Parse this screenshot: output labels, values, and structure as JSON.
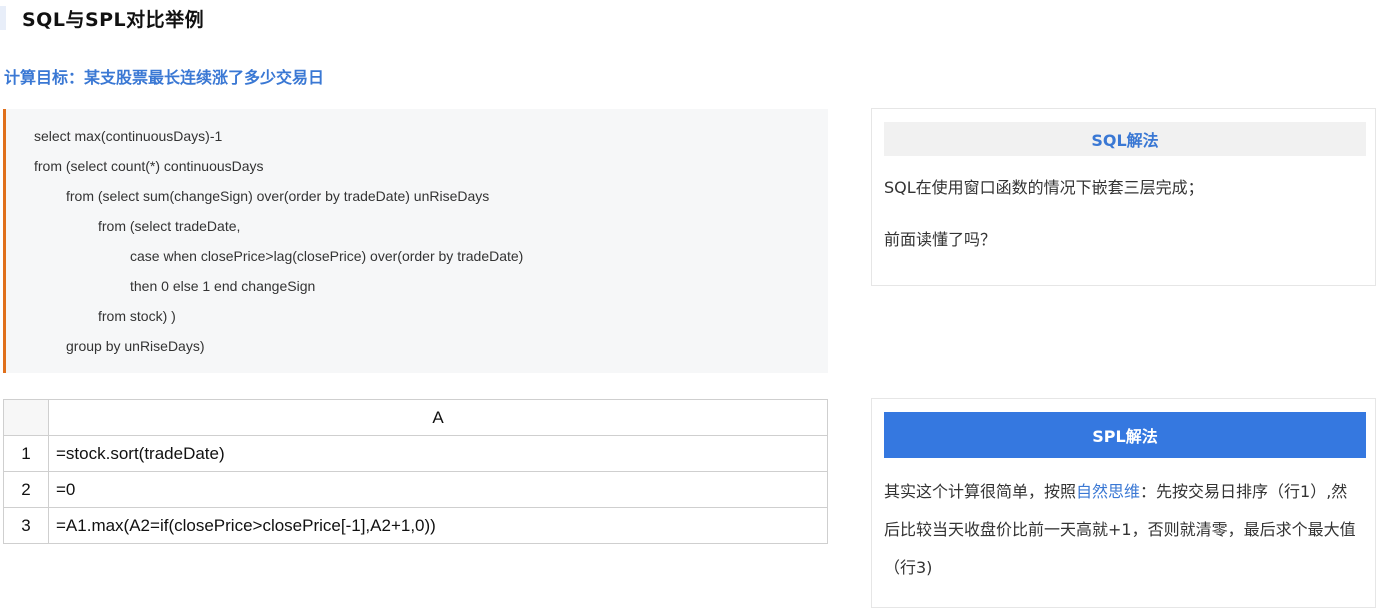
{
  "page": {
    "title": "SQL与SPL对比举例",
    "goal": "计算目标：某支股票最长连续涨了多少交易日"
  },
  "code": {
    "lines": [
      "select max(continuousDays)-1",
      "from (select count(*) continuousDays",
      "from (select sum(changeSign) over(order by tradeDate) unRiseDays",
      "from (select tradeDate,",
      "case when closePrice>lag(closePrice) over(order by tradeDate)",
      "then 0 else 1 end changeSign",
      "from stock) )",
      "group by unRiseDays)"
    ]
  },
  "sql_card": {
    "heading": "SQL解法",
    "line1": "SQL在使用窗口函数的情况下嵌套三层完成；",
    "line2": "前面读懂了吗？"
  },
  "grid": {
    "column_header": "A",
    "rows": [
      {
        "num": "1",
        "formula": "=stock.sort(tradeDate)"
      },
      {
        "num": "2",
        "formula": "=0"
      },
      {
        "num": "3",
        "formula": "=A1.max(A2=if(closePrice>closePrice[-1],A2+1,0))"
      }
    ]
  },
  "spl_card": {
    "heading": "SPL解法",
    "text_before_link": "其实这个计算很简单，按照",
    "link_text": "自然思维",
    "text_after_link": "：先按交易日排序（行1）,然后比较当天收盘价比前一天高就+1，否则就清零，最后求个最大值（行3)"
  }
}
